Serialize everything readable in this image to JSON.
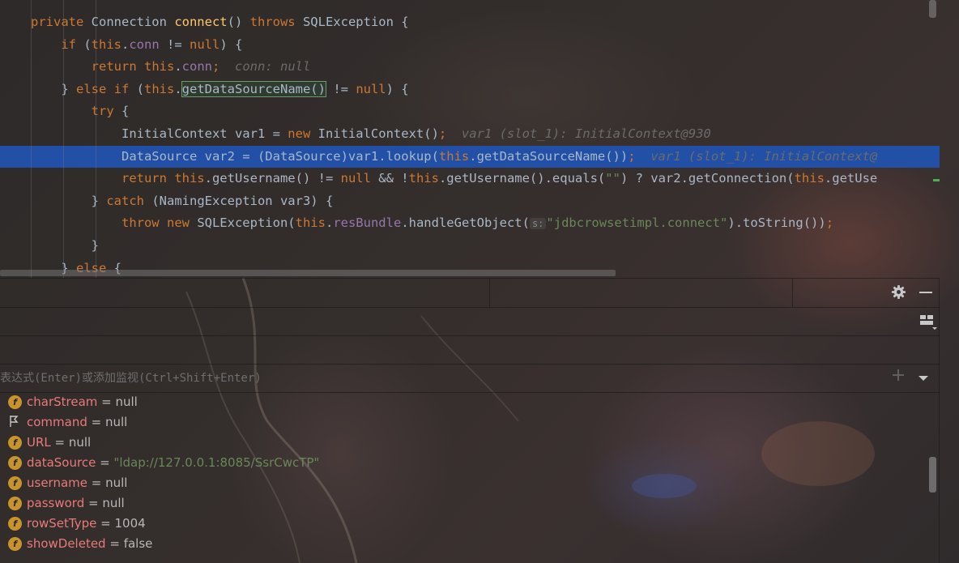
{
  "editor": {
    "lines": [
      [
        {
          "t": "private ",
          "c": "kw"
        },
        {
          "t": "Connection "
        },
        {
          "t": "connect",
          "c": "mth"
        },
        {
          "t": "() "
        },
        {
          "t": "throws ",
          "c": "kw"
        },
        {
          "t": "SQLException {"
        }
      ],
      [
        {
          "t": "    "
        },
        {
          "t": "if ",
          "c": "kw"
        },
        {
          "t": "("
        },
        {
          "t": "this",
          "c": "kw"
        },
        {
          "t": "."
        },
        {
          "t": "conn",
          "c": "fld"
        },
        {
          "t": " != "
        },
        {
          "t": "null",
          "c": "kw"
        },
        {
          "t": ") {"
        }
      ],
      [
        {
          "t": "        "
        },
        {
          "t": "return ",
          "c": "kw"
        },
        {
          "t": "this",
          "c": "kw"
        },
        {
          "t": "."
        },
        {
          "t": "conn",
          "c": "fld"
        },
        {
          "t": ";",
          "c": "kw"
        },
        {
          "t": "  conn: null",
          "c": "hint"
        }
      ],
      [
        {
          "t": "    } "
        },
        {
          "t": "else if ",
          "c": "kw"
        },
        {
          "t": "("
        },
        {
          "t": "this",
          "c": "kw"
        },
        {
          "t": "."
        },
        {
          "t": "getDataSourceName()",
          "c": "boxed"
        },
        {
          "t": " != "
        },
        {
          "t": "null",
          "c": "kw"
        },
        {
          "t": ") {"
        }
      ],
      [
        {
          "t": "        "
        },
        {
          "t": "try ",
          "c": "kw"
        },
        {
          "t": "{"
        }
      ],
      [
        {
          "t": "            InitialContext var1 = "
        },
        {
          "t": "new ",
          "c": "kw"
        },
        {
          "t": "InitialContext()"
        },
        {
          "t": ";",
          "c": "kw"
        },
        {
          "t": "  var1 (slot_1): InitialContext@930",
          "c": "hint"
        }
      ],
      [
        {
          "t": "            DataSource var2 = (DataSource)var1.lookup("
        },
        {
          "t": "this",
          "c": "kw"
        },
        {
          "t": ".getDataSourceName())"
        },
        {
          "t": ";",
          "c": "kw"
        },
        {
          "t": "  var1 (slot_1): InitialContext@",
          "c": "hint"
        }
      ],
      [
        {
          "t": "            "
        },
        {
          "t": "return ",
          "c": "kw"
        },
        {
          "t": "this",
          "c": "kw"
        },
        {
          "t": ".getUsername() != "
        },
        {
          "t": "null ",
          "c": "kw"
        },
        {
          "t": "&& !"
        },
        {
          "t": "this",
          "c": "kw"
        },
        {
          "t": ".getUsername().equals("
        },
        {
          "t": "\"\"",
          "c": "str"
        },
        {
          "t": ") ? var2.getConnection("
        },
        {
          "t": "this",
          "c": "kw"
        },
        {
          "t": ".getUse"
        }
      ],
      [
        {
          "t": "        } "
        },
        {
          "t": "catch ",
          "c": "kw"
        },
        {
          "t": "(NamingException var3) {"
        }
      ],
      [
        {
          "t": "            "
        },
        {
          "t": "throw ",
          "c": "kw"
        },
        {
          "t": "new ",
          "c": "kw"
        },
        {
          "t": "SQLException("
        },
        {
          "t": "this",
          "c": "kw"
        },
        {
          "t": "."
        },
        {
          "t": "resBundle",
          "c": "fld"
        },
        {
          "t": ".handleGetObject("
        },
        {
          "t": "s:",
          "c": "param"
        },
        {
          "t": "\"jdbcrowsetimpl.connect\"",
          "c": "str"
        },
        {
          "t": ").toString())"
        },
        {
          "t": ";",
          "c": "kw"
        }
      ],
      [
        {
          "t": "        }"
        }
      ],
      [
        {
          "t": "    } "
        },
        {
          "t": "else ",
          "c": "kw"
        },
        {
          "t": "{"
        }
      ]
    ],
    "highlighted_line": 6
  },
  "watch": {
    "placeholder": "表达式(Enter)或添加监视(Ctrl+Shift+Enter)"
  },
  "variables": [
    {
      "icon": "f",
      "name": "charStream",
      "eq": " = ",
      "value": "null",
      "str": false
    },
    {
      "icon": "flag",
      "name": "command",
      "eq": " = ",
      "value": "null",
      "str": false
    },
    {
      "icon": "f",
      "name": "URL",
      "eq": " = ",
      "value": "null",
      "str": false
    },
    {
      "icon": "f",
      "name": "dataSource",
      "eq": " = ",
      "value": "\"ldap://127.0.0.1:8085/SsrCwcTP\"",
      "str": true
    },
    {
      "icon": "f",
      "name": "username",
      "eq": " = ",
      "value": "null",
      "str": false
    },
    {
      "icon": "f",
      "name": "password",
      "eq": " = ",
      "value": "null",
      "str": false
    },
    {
      "icon": "f",
      "name": "rowSetType",
      "eq": " = ",
      "value": "1004",
      "str": false
    },
    {
      "icon": "f",
      "name": "showDeleted",
      "eq": " = ",
      "value": "false",
      "str": false
    }
  ],
  "icons": {
    "settings": "gear-icon",
    "minimize": "minimize-icon",
    "layout": "layout-icon",
    "add": "plus-icon",
    "dropdown": "chevron-down-icon"
  },
  "colors": {
    "highlight": "#2150a6",
    "keyword": "#cc7832",
    "string": "#6a8759",
    "field": "#9876aa",
    "var_name": "#e87a7a",
    "field_icon": "#c9932c"
  }
}
